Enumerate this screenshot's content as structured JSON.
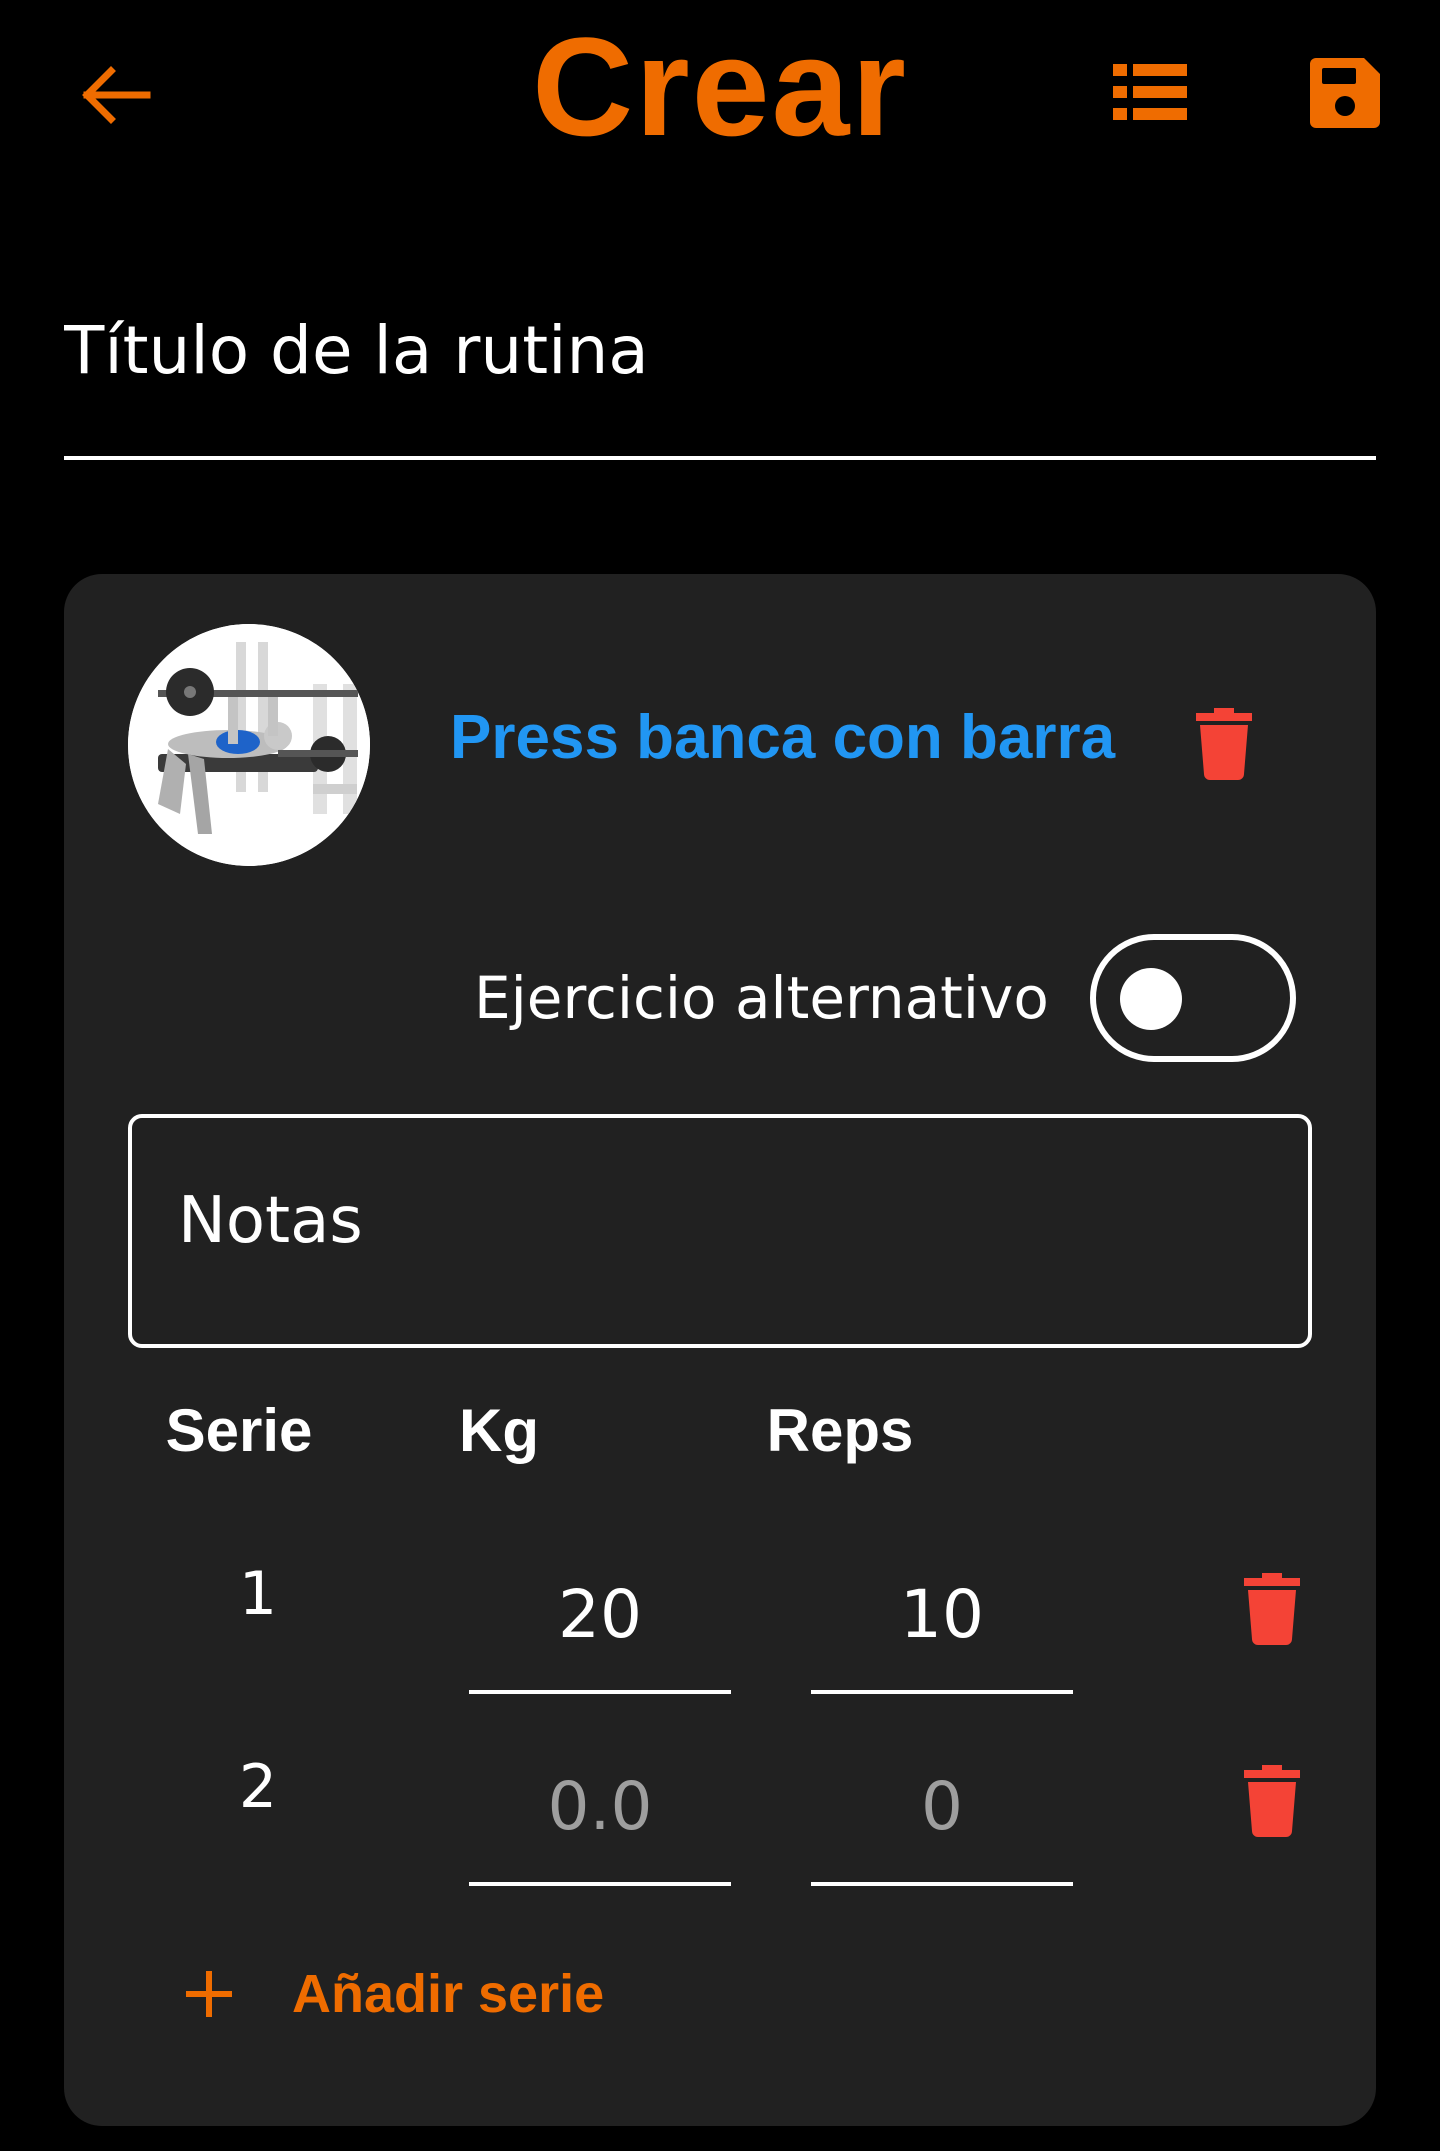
{
  "header": {
    "title": "Crear",
    "accent_color": "#ef6c00",
    "icons": {
      "back": "arrow-left-icon",
      "list": "list-icon",
      "save": "save-icon"
    }
  },
  "routine_title": {
    "placeholder": "Título de la rutina",
    "value": ""
  },
  "exercise": {
    "name": "Press banca con barra",
    "name_color": "#2196f3",
    "image": "bench-press-illustration",
    "delete_icon": "trash-icon",
    "delete_color": "#f44336",
    "alternative": {
      "label": "Ejercicio alternativo",
      "enabled": false
    },
    "notes": {
      "placeholder": "Notas",
      "value": ""
    },
    "table": {
      "headers": {
        "serie": "Serie",
        "kg": "Kg",
        "reps": "Reps"
      },
      "rows": [
        {
          "serie": "1",
          "kg": "20",
          "kg_placeholder": "0.0",
          "reps": "10",
          "reps_placeholder": "0"
        },
        {
          "serie": "2",
          "kg": "",
          "kg_placeholder": "0.0",
          "reps": "",
          "reps_placeholder": "0"
        }
      ]
    },
    "add_series_label": "Añadir serie"
  }
}
